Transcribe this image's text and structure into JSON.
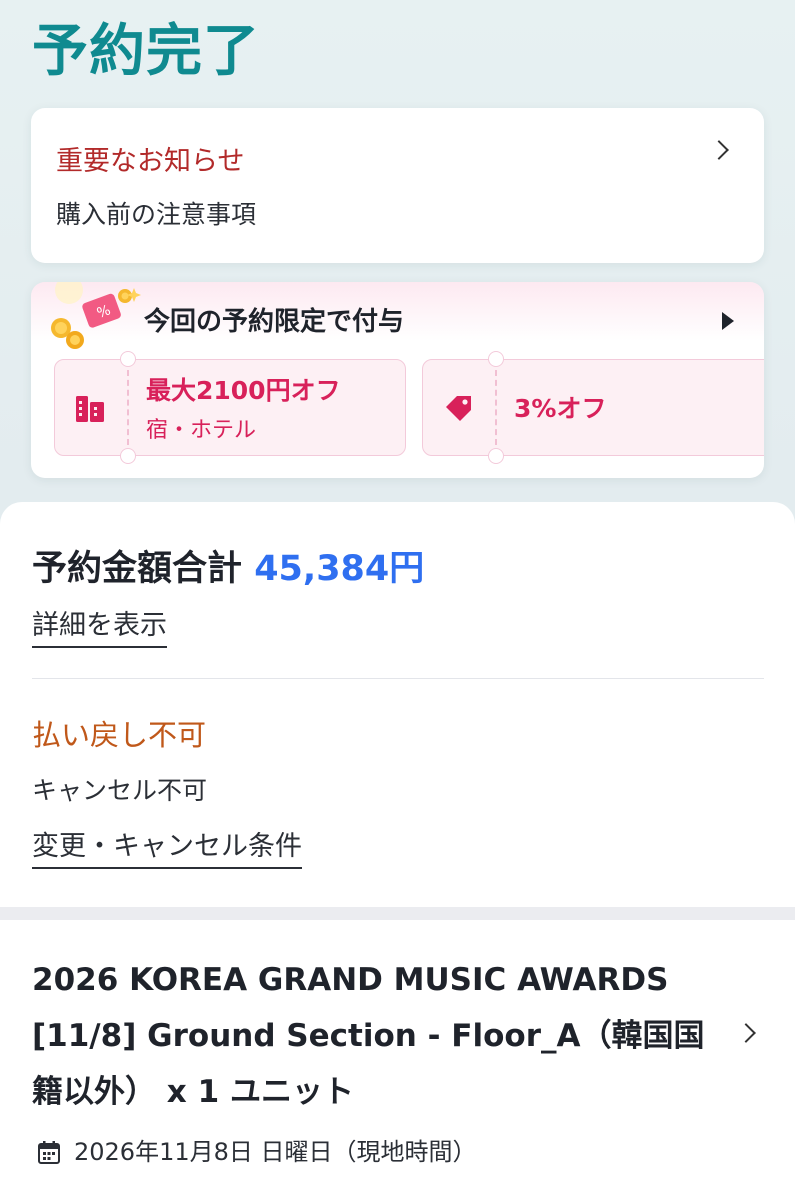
{
  "header": {
    "title": "予約完了"
  },
  "notice": {
    "title": "重要なお知らせ",
    "subtitle": "購入前の注意事項"
  },
  "promo": {
    "header": "今回の予約限定で付与",
    "coupons": [
      {
        "icon": "building-icon",
        "title": "最大2100円オフ",
        "subtitle": "宿・ホテル"
      },
      {
        "icon": "tag-icon",
        "title": "3%オフ"
      }
    ]
  },
  "summary": {
    "total_label": "予約金額合計",
    "total_value": "45,384円",
    "details_link": "詳細を表示"
  },
  "cancellation": {
    "title": "払い戻し不可",
    "subtitle": "キャンセル不可",
    "conditions_link": "変更・キャンセル条件"
  },
  "event": {
    "title": "2026 KOREA GRAND MUSIC AWARDS [11/8] Ground Section - Floor_A（韓国国籍以外） x 1 ユニット",
    "date": "2026年11月8日 日曜日（現地時間）"
  },
  "colors": {
    "title_teal": "#0f8a90",
    "notice_red": "#b22a2a",
    "coupon_pink": "#d8215a",
    "price_blue": "#2f6ff0",
    "refund_orange": "#c0581a"
  }
}
